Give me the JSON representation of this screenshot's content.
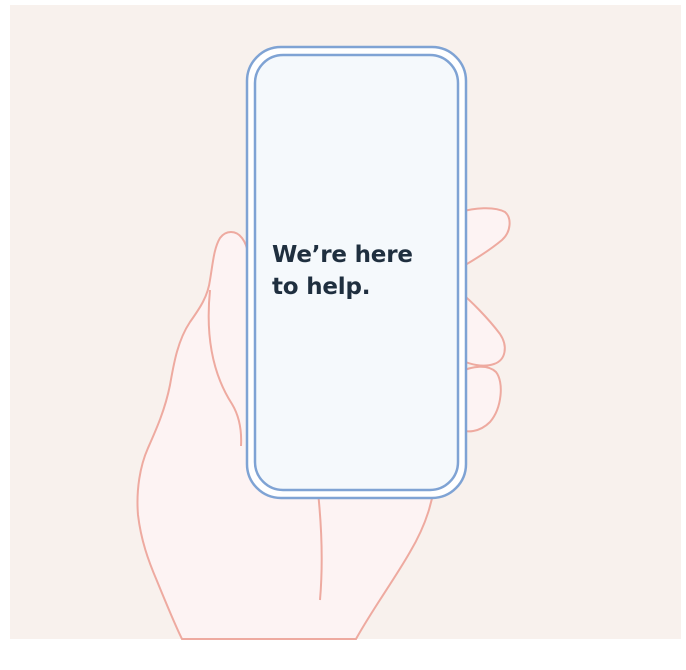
{
  "colors": {
    "page_background": "#ffffff",
    "panel_background": "#f8f1ed",
    "hand_fill": "#fdf3f3",
    "hand_stroke": "#eeaaa0",
    "phone_frame": "#ffffff",
    "phone_stroke": "#7fa3d4",
    "phone_screen": "#f5f9fc",
    "text": "#1f2f3f"
  },
  "illustration": {
    "subject": "hand-holding-phone",
    "icon": "smartphone-icon"
  },
  "phone_screen": {
    "message_line_1": "We’re here",
    "message_line_2": "to help."
  }
}
